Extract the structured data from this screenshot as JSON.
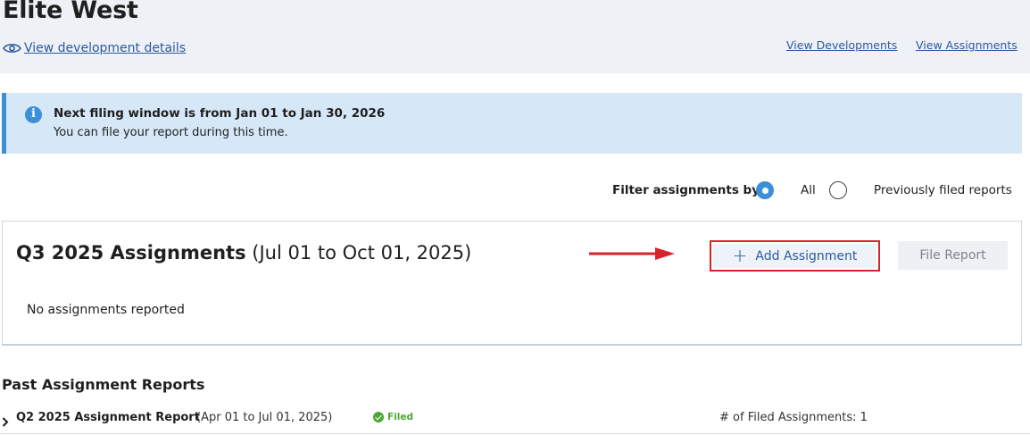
{
  "header": {
    "title": "Elite West",
    "view_details_label": "View development details",
    "view_developments_label": "View Developments",
    "view_assignments_label": "View Assignments"
  },
  "banner": {
    "icon": "info-icon",
    "title": "Next filing window is from Jan 01 to Jan 30, 2026",
    "subtitle": "You can file your report during this time."
  },
  "filter": {
    "label": "Filter assignments by:",
    "options": [
      {
        "label": "All",
        "selected": true
      },
      {
        "label": "Previously filed reports",
        "selected": false
      }
    ]
  },
  "current": {
    "title": "Q3 2025 Assignments",
    "range": "(Jul 01 to Oct 01, 2025)",
    "add_button_label": "Add Assignment",
    "file_button_label": "File Report",
    "empty_message": "No assignments reported"
  },
  "past": {
    "title": "Past Assignment Reports",
    "reports": [
      {
        "name": "Q2 2025 Assignment Report",
        "range": "(Apr 01 to Jul 01, 2025)",
        "status": "Filed",
        "count_label": "# of Filed Assignments: 1"
      }
    ]
  },
  "colors": {
    "accent": "#3d8fd9",
    "link": "#2c5a9e",
    "highlight": "#d9232a",
    "status_filed": "#4aa832",
    "banner_bg": "#d6e8f8",
    "header_bg": "#eef1f5"
  }
}
